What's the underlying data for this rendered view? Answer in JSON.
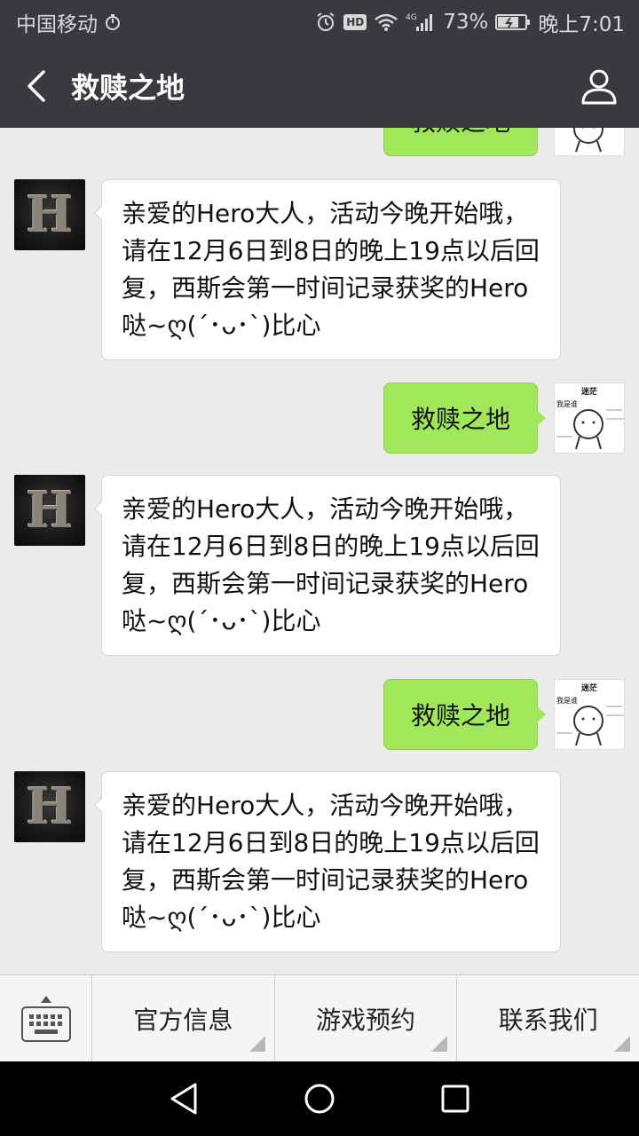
{
  "status_bar": {
    "carrier": "中国移动",
    "network": "4G",
    "battery": "73%",
    "time": "晚上7:01"
  },
  "header": {
    "title": "救赎之地"
  },
  "messages": {
    "top_partial": {
      "text": "救赎之地"
    },
    "bot_1": {
      "text": "亲爱的Hero大人，活动今晚开始哦，请在12月6日到8日的晚上19点以后回复，西斯会第一时间记录获奖的Hero哒~ღ(´･ᴗ･`)比心"
    },
    "user_1": {
      "text": "救赎之地"
    },
    "bot_2": {
      "text": "亲爱的Hero大人，活动今晚开始哦，请在12月6日到8日的晚上19点以后回复，西斯会第一时间记录获奖的Hero哒~ღ(´･ᴗ･`)比心"
    },
    "user_2": {
      "text": "救赎之地"
    },
    "bot_3": {
      "text": "亲爱的Hero大人，活动今晚开始哦，请在12月6日到8日的晚上19点以后回复，西斯会第一时间记录获奖的Hero哒~ღ(´･ᴗ･`)比心"
    }
  },
  "bot_avatar": {
    "letter": "H"
  },
  "user_avatar": {
    "label": "迷茫",
    "sub_label": "我是谁"
  },
  "bottom_menu": {
    "tabs": [
      {
        "label": "官方信息"
      },
      {
        "label": "游戏预约"
      },
      {
        "label": "联系我们"
      }
    ]
  },
  "icons": {
    "back": "chevron-left-icon",
    "profile": "person-icon",
    "keyboard": "keyboard-icon"
  },
  "colors": {
    "header_bg": "#393a3f",
    "user_bubble": "#a0e75a",
    "bot_bubble": "#ffffff",
    "chat_bg": "#ebebeb"
  }
}
